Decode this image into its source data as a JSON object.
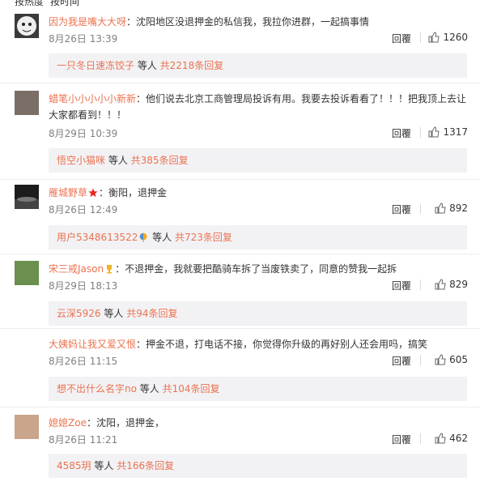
{
  "topbar": {
    "left": "按热度",
    "right": "按时间"
  },
  "comments": [
    {
      "user": "因为我是嘴大大呀",
      "text": "：沈阳地区没退押金的私信我，我拉你进群，一起搞事情",
      "date": "8月26日 13:39",
      "reply_label": "回覆",
      "likes": "1260",
      "reply_user": "一只冬日速冻饺子",
      "reply_mid": " 等人",
      "reply_count": " 共2218条回复"
    },
    {
      "user": "蜡笔小小小小小新新",
      "text": "：他们说去北京工商管理局投诉有用。我要去投诉看看了！！！把我顶上去让大家都看到！！！",
      "date": "8月29日 10:39",
      "reply_label": "回覆",
      "likes": "1317",
      "reply_user": "悟空小猫咪",
      "reply_mid": " 等人",
      "reply_count": " 共385条回复"
    },
    {
      "user": "雁城野草",
      "text": "：衡阳，退押金",
      "date": "8月26日 12:49",
      "reply_label": "回覆",
      "likes": "892",
      "reply_user": "用户5348613522",
      "reply_mid": " 等人",
      "reply_count": " 共723条回复"
    },
    {
      "user": "宋三戒Jason",
      "text": "：不退押金，我就要把酷骑车拆了当废铁卖了，同意的赞我一起拆",
      "date": "8月29日 18:13",
      "reply_label": "回覆",
      "likes": "829",
      "reply_user": "云深5926",
      "reply_mid": " 等人",
      "reply_count": " 共94条回复"
    },
    {
      "user": "大姨妈让我又爱又恨",
      "text": "：押金不退，打电话不接，你觉得你升级的再好别人还会用吗，搞笑",
      "date": "8月26日 11:15",
      "reply_label": "回覆",
      "likes": "605",
      "reply_user": "想不出什么名字no",
      "reply_mid": " 等人",
      "reply_count": " 共104条回复"
    },
    {
      "user": "媳媳Zoe",
      "text": "：沈阳，退押金，",
      "date": "8月26日 11:21",
      "reply_label": "回覆",
      "likes": "462",
      "reply_user": "4585玥",
      "reply_mid": " 等人",
      "reply_count": " 共166条回复"
    }
  ],
  "colors": {
    "username": "#eb7350",
    "reply_bg": "#f2f2f5",
    "date": "#808080"
  }
}
